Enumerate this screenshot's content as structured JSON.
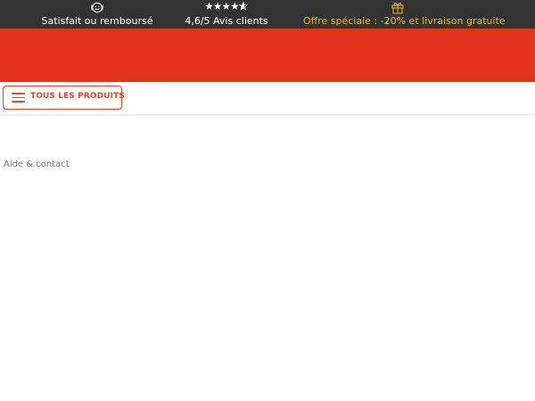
{
  "topbar": {
    "guarantee": {
      "icon": "smiley-badge-icon",
      "label": "Satisfait ou remboursé"
    },
    "reviews": {
      "icon": "stars-icon",
      "label": "4,6/5 Avis clients",
      "rating": 4.6
    },
    "offer": {
      "icon": "gift-icon",
      "label": "Offre spéciale : -20% et livraison gratuite"
    }
  },
  "colors": {
    "topbar_bg": "#333333",
    "banner": "#e5321b",
    "accent": "#d9492c",
    "offer_text": "#f3b41e"
  },
  "nav": {
    "products_button": {
      "icon": "menu-icon",
      "label": "TOUS LES PRODUITS"
    }
  },
  "footer": {
    "help_link": "Aide & contact"
  }
}
